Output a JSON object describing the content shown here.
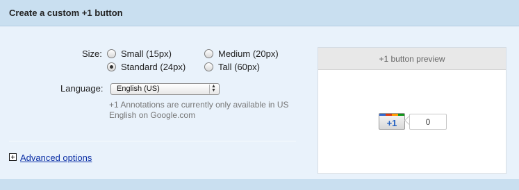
{
  "header": {
    "title": "Create a custom +1 button"
  },
  "size": {
    "label": "Size:",
    "options": [
      {
        "label": "Small (15px)",
        "checked": false
      },
      {
        "label": "Medium (20px)",
        "checked": false
      },
      {
        "label": "Standard (24px)",
        "checked": true
      },
      {
        "label": "Tall (60px)",
        "checked": false
      }
    ]
  },
  "language": {
    "label": "Language:",
    "selected": "English (US)",
    "arrow_icon": "updown-arrows-icon"
  },
  "note": "+1 Annotations are currently only available in US English on Google.com",
  "advanced": {
    "icon": "plus-box-icon",
    "label": "Advanced options"
  },
  "preview": {
    "title": "+1 button preview",
    "button_label": "+1",
    "count": "0",
    "stripe_colors": [
      "#3366cc",
      "#dc3912",
      "#ff9900",
      "#109618"
    ]
  }
}
